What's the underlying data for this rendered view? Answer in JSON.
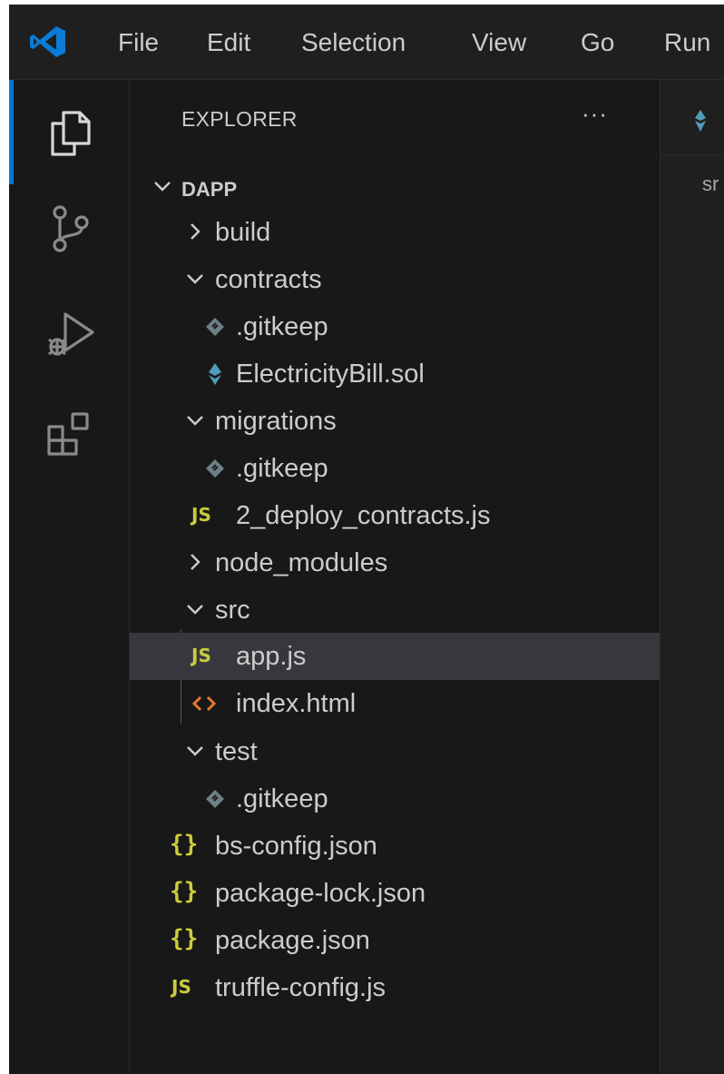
{
  "menu": [
    "File",
    "Edit",
    "Selection",
    "View",
    "Go",
    "Run"
  ],
  "sidebar": {
    "title": "EXPLORER",
    "more": "···",
    "tree": [
      {
        "label": "DAPP",
        "kind": "root",
        "expanded": true
      },
      {
        "label": "build",
        "kind": "folder",
        "expanded": false
      },
      {
        "label": "contracts",
        "kind": "folder",
        "expanded": true
      },
      {
        "label": ".gitkeep",
        "kind": "gitkeep"
      },
      {
        "label": "ElectricityBill.sol",
        "kind": "sol"
      },
      {
        "label": "migrations",
        "kind": "folder",
        "expanded": true
      },
      {
        "label": ".gitkeep",
        "kind": "gitkeep"
      },
      {
        "label": "2_deploy_contracts.js",
        "kind": "js"
      },
      {
        "label": "node_modules",
        "kind": "folder",
        "expanded": false
      },
      {
        "label": "src",
        "kind": "folder",
        "expanded": true
      },
      {
        "label": "app.js",
        "kind": "js",
        "selected": true
      },
      {
        "label": "index.html",
        "kind": "html"
      },
      {
        "label": "test",
        "kind": "folder",
        "expanded": true
      },
      {
        "label": ".gitkeep",
        "kind": "gitkeep"
      },
      {
        "label": "bs-config.json",
        "kind": "json"
      },
      {
        "label": "package-lock.json",
        "kind": "json"
      },
      {
        "label": "package.json",
        "kind": "json"
      },
      {
        "label": "truffle-config.js",
        "kind": "js"
      }
    ],
    "icons": {
      "js": "JS",
      "json": "{}"
    }
  },
  "editor": {
    "breadcrumb": "sr"
  },
  "colors": {
    "accent": "#0078d4",
    "js": "#cbcb41",
    "html": "#e37933",
    "sol": "#519aba",
    "gitkeep": "#6d8086",
    "vscode_logo": "#0a7bd6"
  },
  "icon_names": [
    "vscode-logo-icon",
    "files-icon",
    "source-control-icon",
    "run-debug-icon",
    "extensions-icon",
    "chevron-right-icon",
    "chevron-down-icon",
    "gitkeep-file-icon",
    "solidity-file-icon",
    "js-file-icon",
    "html-file-icon",
    "json-file-icon"
  ]
}
